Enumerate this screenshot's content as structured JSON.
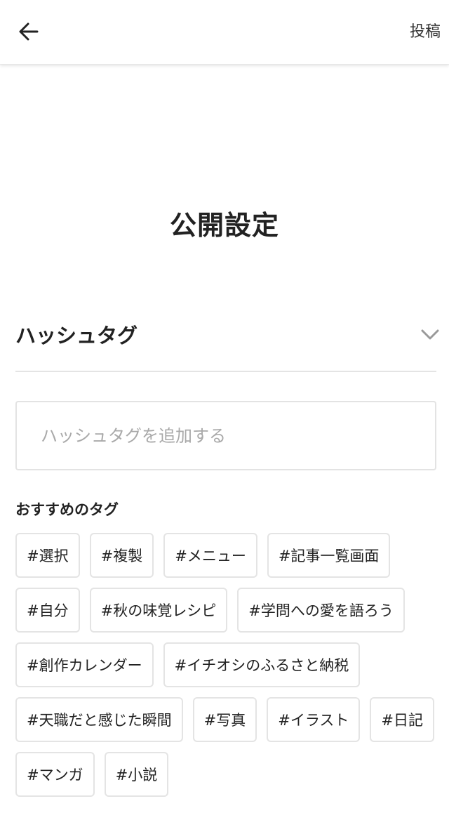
{
  "header": {
    "back_icon": "arrow-left-icon",
    "post_label": "投稿"
  },
  "main": {
    "title": "公開設定"
  },
  "hashtag_section": {
    "title": "ハッシュタグ",
    "chevron_icon": "chevron-down-icon",
    "input_placeholder": "ハッシュタグを追加する",
    "input_value": "",
    "recommended_title": "おすすめのタグ",
    "tags": [
      "#選択",
      "#複製",
      "#メニュー",
      "#記事一覧画面",
      "#自分",
      "#秋の味覚レシピ",
      "#学問への愛を語ろう",
      "#創作カレンダー",
      "#イチオシのふるさと納税",
      "#天職だと感じた瞬間",
      "#写真",
      "#イラスト",
      "#日記",
      "#マンガ",
      "#小説"
    ]
  },
  "colors": {
    "text": "#222222",
    "border": "#e4e4e4",
    "placeholder": "#a9a9a9",
    "chevron": "#9a9a9a"
  }
}
